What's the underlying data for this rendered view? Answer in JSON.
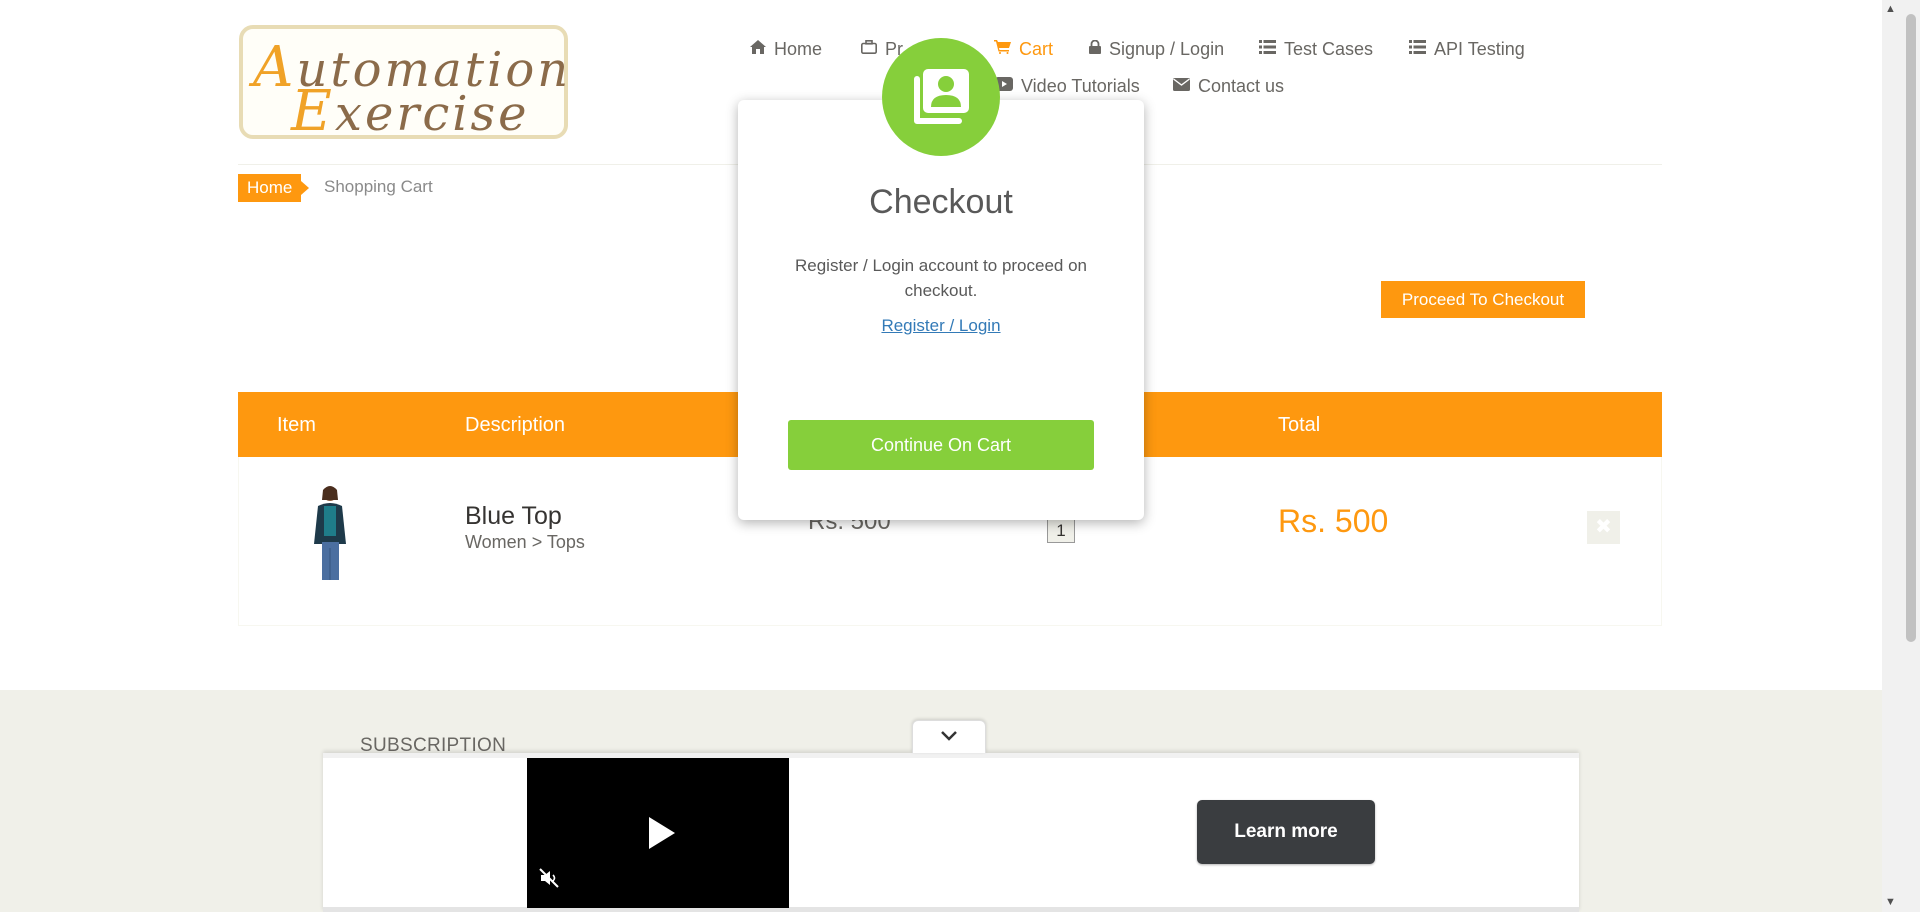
{
  "logo": {
    "line1_cap": "A",
    "line1_rest": "utomation",
    "line2_cap": "E",
    "line2_rest": "xercise"
  },
  "nav": {
    "home": "Home",
    "products": "Pr",
    "cart": "Cart",
    "signup_login": "Signup / Login",
    "test_cases": "Test Cases",
    "api_testing": "API Testing",
    "video_tutorials": "Video Tutorials",
    "contact_us": "Contact us"
  },
  "breadcrumb": {
    "home": "Home",
    "current": "Shopping Cart"
  },
  "proceed_button": "Proceed To Checkout",
  "table": {
    "headers": {
      "item": "Item",
      "description": "Description",
      "total": "Total"
    },
    "rows": [
      {
        "name": "Blue Top",
        "category": "Women > Tops",
        "price": "Rs. 500",
        "quantity": "1",
        "total": "Rs. 500",
        "delete": "✖"
      }
    ]
  },
  "footer": {
    "subscription": "SUBSCRIPTION"
  },
  "modal": {
    "title": "Checkout",
    "body": "Register / Login account to proceed on checkout.",
    "link": "Register / Login",
    "continue_button": "Continue On Cart"
  },
  "ad": {
    "learn_more": "Learn more"
  },
  "colors": {
    "accent": "#fe980f",
    "success": "#86cf3b",
    "link": "#337ab7",
    "text": "#696763"
  }
}
